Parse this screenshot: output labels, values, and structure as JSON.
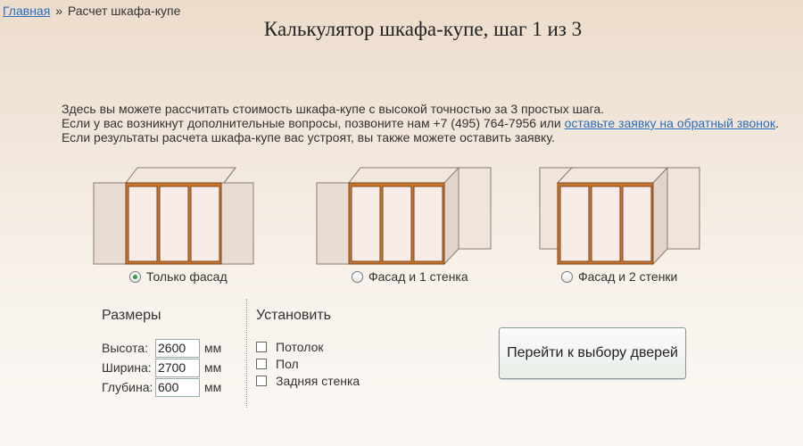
{
  "breadcrumb": {
    "home_link": "Главная",
    "separator": "»",
    "current": "Расчет шкафа-купе"
  },
  "page_title": "Калькулятор шкафа-купе, шаг 1 из 3",
  "intro": {
    "line1": "Здесь вы можете рассчитать стоимость шкафа-купе с высокой точностью за 3 простых шага.",
    "line2_prefix": "Если у вас возникнут дополнительные вопросы, позвоните нам +7 (495) 764-7956 или ",
    "line2_link": "оставьте заявку на обратный звонок",
    "line2_suffix": ".",
    "line3": "Если результаты расчета шкафа-купе вас устроят, вы также можете оставить заявку."
  },
  "options": [
    {
      "label": "Только фасад",
      "checked": true,
      "icon": "wardrobe-facade-only-icon"
    },
    {
      "label": "Фасад и 1 стенка",
      "checked": false,
      "icon": "wardrobe-facade-one-wall-icon"
    },
    {
      "label": "Фасад и 2 стенки",
      "checked": false,
      "icon": "wardrobe-facade-two-walls-icon"
    }
  ],
  "sizes": {
    "title": "Размеры",
    "unit": "мм",
    "height": {
      "label": "Высота:",
      "value": "2600"
    },
    "width": {
      "label": "Ширина:",
      "value": "2700"
    },
    "depth": {
      "label": "Глубина:",
      "value": "600"
    }
  },
  "install": {
    "title": "Установить",
    "ceiling": {
      "label": "Потолок",
      "checked": false
    },
    "floor": {
      "label": "Пол",
      "checked": false
    },
    "back_wall": {
      "label": "Задняя стенка",
      "checked": false
    }
  },
  "next_button": "Перейти к выбору дверей",
  "colors": {
    "link": "#2a6fbf",
    "door_frame": "#c9772f",
    "wall": "#e9ddd3",
    "radio_selected": "#3a9a3a"
  }
}
